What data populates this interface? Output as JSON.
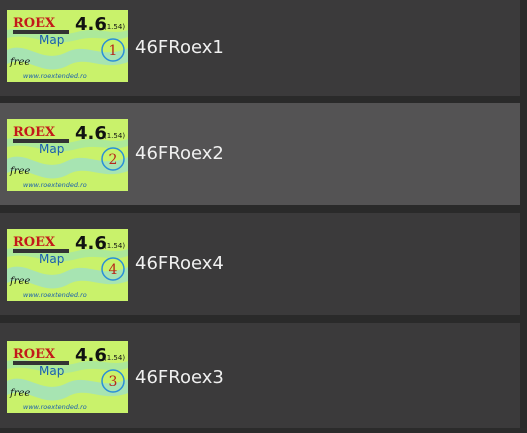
{
  "maps": [
    {
      "name": "46FRoex1",
      "selected": false,
      "thumbnail": {
        "brand": "ROEX",
        "map_label": "Map",
        "version": "4.6",
        "sub_version": "(1.54)",
        "free_label": "free",
        "url": "www.roextended.ro",
        "number": "1"
      }
    },
    {
      "name": "46FRoex2",
      "selected": true,
      "thumbnail": {
        "brand": "ROEX",
        "map_label": "Map",
        "version": "4.6",
        "sub_version": "(1.54)",
        "free_label": "free",
        "url": "www.roextended.ro",
        "number": "2"
      }
    },
    {
      "name": "46FRoex4",
      "selected": false,
      "thumbnail": {
        "brand": "ROEX",
        "map_label": "Map",
        "version": "4.6",
        "sub_version": "(1.54)",
        "free_label": "free",
        "url": "www.roextended.ro",
        "number": "4"
      }
    },
    {
      "name": "46FRoex3",
      "selected": false,
      "thumbnail": {
        "brand": "ROEX",
        "map_label": "Map",
        "version": "4.6",
        "sub_version": "(1.54)",
        "free_label": "free",
        "url": "www.roextended.ro",
        "number": "3"
      }
    }
  ],
  "colors": {
    "list_bg": "#2a2a2a",
    "item_bg": "#3b3a3b",
    "item_selected_bg": "#545354",
    "name_text": "#f0f0f0",
    "thumb_green": "#c9f26b",
    "thumb_swirl": "#8fd8c8",
    "brand_red": "#c21a1a",
    "map_blue": "#1c5fae",
    "number_ring": "#2a8fd8",
    "number_text": "#b8261a"
  }
}
